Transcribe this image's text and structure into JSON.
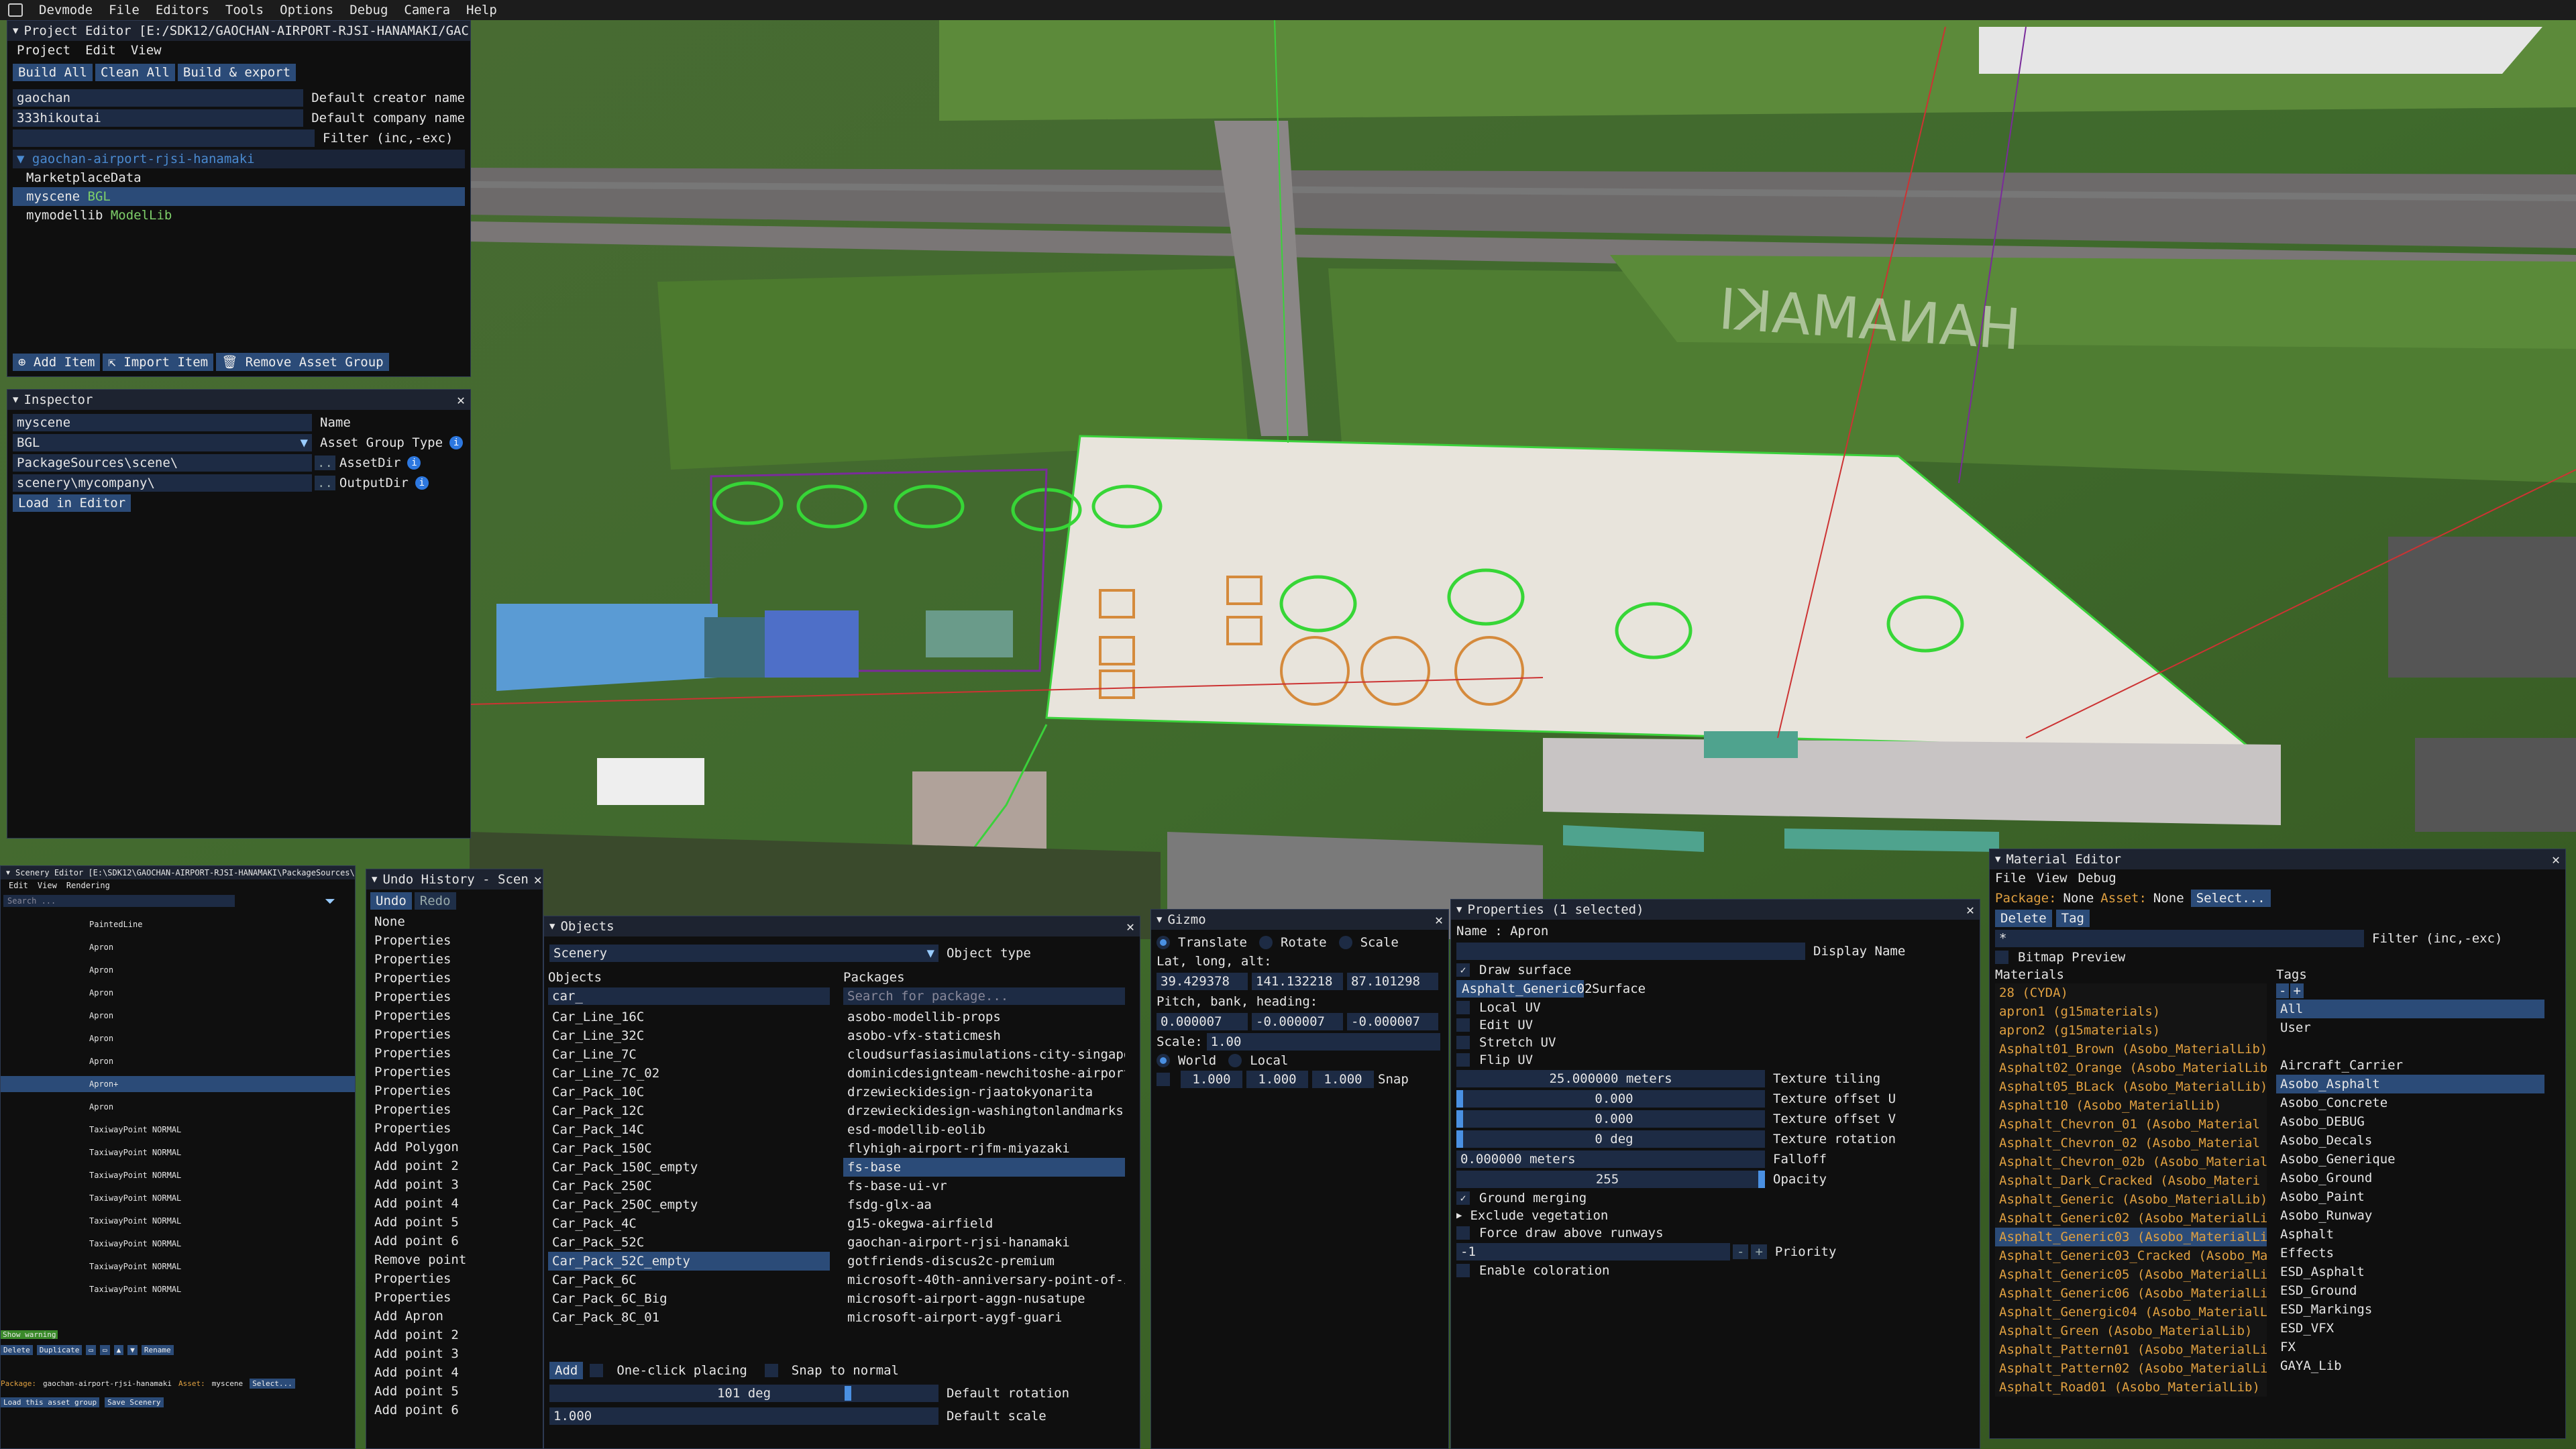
{
  "menubar": {
    "items": [
      "Devmode",
      "File",
      "Editors",
      "Tools",
      "Options",
      "Debug",
      "Camera",
      "Help"
    ]
  },
  "project_editor": {
    "title": "Project Editor [E:/SDK12/GAOCHAN-AIRPORT-RJSI-HANAMAKI/GAC",
    "menu": [
      "Project",
      "Edit",
      "View"
    ],
    "buttons": [
      "Build All",
      "Clean All",
      "Build & export"
    ],
    "creator_value": "gaochan",
    "creator_label": "Default creator name",
    "company_value": "333hikoutai",
    "company_label": "Default company name",
    "filter_label": "Filter (inc,-exc)",
    "tree": [
      {
        "name": "gaochan-airport-rjsi-hanamaki",
        "tag": ""
      },
      {
        "name": "MarketplaceData",
        "tag": ""
      },
      {
        "name": "myscene",
        "tag": "BGL"
      },
      {
        "name": "mymodellib",
        "tag": "ModelLib"
      }
    ],
    "bottom_buttons": [
      "Add Item",
      "Import Item",
      "Remove Asset Group"
    ]
  },
  "inspector": {
    "title": "Inspector",
    "name_value": "myscene",
    "name_label": "Name",
    "type_value": "BGL",
    "type_label": "Asset Group Type",
    "assetdir_value": "PackageSources\\scene\\",
    "assetdir_label": "AssetDir",
    "outputdir_value": "scenery\\mycompany\\",
    "outputdir_label": "OutputDir",
    "load_button": "Load in Editor"
  },
  "scenery_editor": {
    "title": "Scenery Editor [E:\\SDK12\\GAOCHAN-AIRPORT-RJSI-HANAMAKI\\PackageSources\\",
    "menu": [
      "Edit",
      "View",
      "Rendering"
    ],
    "search_placeholder": "Search ...",
    "items": [
      "PaintedLine",
      "Apron",
      "Apron",
      "Apron",
      "Apron",
      "Apron",
      "Apron",
      "Apron+",
      "Apron",
      "TaxiwayPoint NORMAL",
      "TaxiwayPoint NORMAL",
      "TaxiwayPoint NORMAL",
      "TaxiwayPoint NORMAL",
      "TaxiwayPoint NORMAL",
      "TaxiwayPoint NORMAL",
      "TaxiwayPoint NORMAL",
      "TaxiwayPoint NORMAL"
    ],
    "show_warning": "Show warning",
    "buttons": [
      "Delete",
      "Duplicate",
      "Rename"
    ],
    "package_label": "Package:",
    "package_value": "gaochan-airport-rjsi-hanamaki",
    "asset_label": "Asset:",
    "asset_value": "myscene",
    "select_button": "Select...",
    "load_button": "Load this asset group",
    "save_button": "Save Scenery"
  },
  "undo_history": {
    "title": "Undo History - Scen",
    "undo": "Undo",
    "redo": "Redo",
    "items": [
      "None",
      "Properties",
      "Properties",
      "Properties",
      "Properties",
      "Properties",
      "Properties",
      "Properties",
      "Properties",
      "Properties",
      "Properties",
      "Properties",
      "Add Polygon",
      "Add point 2",
      "Add point 3",
      "Add point 4",
      "Add point 5",
      "Add point 6",
      "Remove point",
      "Properties",
      "Properties",
      "Add Apron",
      "Add point 2",
      "Add point 3",
      "Add point 4",
      "Add point 5",
      "Add point 6"
    ]
  },
  "objects": {
    "title": "Objects",
    "type_value": "Scenery",
    "type_label": "Object type",
    "objects_header": "Objects",
    "packages_header": "Packages",
    "objects_search": "car_",
    "packages_search_placeholder": "Search for package...",
    "objects": [
      "Car_Line_16C",
      "Car_Line_32C",
      "Car_Line_7C",
      "Car_Line_7C_02",
      "Car_Pack_10C",
      "Car_Pack_12C",
      "Car_Pack_14C",
      "Car_Pack_150C",
      "Car_Pack_150C_empty",
      "Car_Pack_250C",
      "Car_Pack_250C_empty",
      "Car_Pack_4C",
      "Car_Pack_52C",
      "Car_Pack_52C_empty",
      "Car_Pack_6C",
      "Car_Pack_6C_Big",
      "Car_Pack_8C_01"
    ],
    "packages": [
      "asobo-modellib-props",
      "asobo-vfx-staticmesh",
      "cloudsurfasiasimulations-city-singapo",
      "dominicdesignteam-newchitoshe-airport",
      "drzewieckidesign-rjaatokyonarita",
      "drzewieckidesign-washingtonlandmarks",
      "esd-modellib-eolib",
      "flyhigh-airport-rjfm-miyazaki",
      "fs-base",
      "fs-base-ui-vr",
      "fsdg-glx-aa",
      "g15-okegwa-airfield",
      "gaochan-airport-rjsi-hanamaki",
      "gotfriends-discus2c-premium",
      "microsoft-40th-anniversary-point-of-i",
      "microsoft-airport-aggn-nusatupe",
      "microsoft-airport-aygf-guari"
    ],
    "add_button": "Add",
    "one_click": "One-click placing",
    "snap_normal": "Snap to normal",
    "rotation_value": "101 deg",
    "rotation_label": "Default rotation",
    "scale_value": "1.000",
    "scale_label": "Default scale"
  },
  "gizmo": {
    "title": "Gizmo",
    "modes": [
      "Translate",
      "Rotate",
      "Scale"
    ],
    "latlon_label": "Lat, long, alt:",
    "lat": "39.429378",
    "lon": "141.132218",
    "alt": "87.101298",
    "pbh_label": "Pitch, bank, heading:",
    "pitch": "0.000007",
    "bank": "-0.000007",
    "heading": "-0.000007",
    "scale_label": "Scale:",
    "scale_value": "1.00",
    "spaces": [
      "World",
      "Local"
    ],
    "snap": [
      "1.000",
      "1.000",
      "1.000"
    ],
    "snap_label": "Snap"
  },
  "properties": {
    "title": "Properties (1 selected)",
    "name_label": "Name :",
    "name_value": "Apron",
    "display_name_label": "Display Name",
    "draw_surface": "Draw surface",
    "surface_value": "Asphalt_Generic02",
    "surface_label": "Surface",
    "checks": [
      "Local UV",
      "Edit UV",
      "Stretch UV",
      "Flip UV"
    ],
    "tiling_value": "25.000000 meters",
    "tiling_label": "Texture tiling",
    "offset_u_value": "0.000",
    "offset_u_label": "Texture offset U",
    "offset_v_value": "0.000",
    "offset_v_label": "Texture offset V",
    "rotation_value": "0 deg",
    "rotation_label": "Texture rotation",
    "falloff_value": "0.000000 meters",
    "falloff_label": "Falloff",
    "opacity_value": "255",
    "opacity_label": "Opacity",
    "ground_merging": "Ground merging",
    "exclude_vegetation": "Exclude vegetation",
    "force_draw": "Force draw above runways",
    "priority_value": "-1",
    "priority_label": "Priority",
    "enable_coloration": "Enable coloration"
  },
  "material_editor": {
    "title": "Material Editor",
    "menu": [
      "File",
      "View",
      "Debug"
    ],
    "package_label": "Package:",
    "package_value": "None",
    "asset_label": "Asset:",
    "asset_value": "None",
    "select_button": "Select...",
    "delete_button": "Delete",
    "tag_button": "Tag",
    "filter_value": "*",
    "filter_label": "Filter (inc,-exc)",
    "bitmap_preview": "Bitmap Preview",
    "materials_header": "Materials",
    "tags_header": "Tags",
    "materials": [
      "28 (CYDA)",
      "apron1 (g15materials)",
      "apron2 (g15materials)",
      "Asphalt01_Brown (Asobo_MaterialLib)",
      "Asphalt02_Orange (Asobo_MaterialLib)",
      "Asphalt05_BLack (Asobo_MaterialLib)",
      "Asphalt10 (Asobo_MaterialLib)",
      "Asphalt_Chevron_01 (Asobo_Material",
      "Asphalt_Chevron_02 (Asobo_Material",
      "Asphalt_Chevron_02b (Asobo_Material",
      "Asphalt_Dark_Cracked (Asobo_Materi",
      "Asphalt_Generic (Asobo_MaterialLib)",
      "Asphalt_Generic02 (Asobo_MaterialLi",
      "Asphalt_Generic03 (Asobo_MaterialLi",
      "Asphalt_Generic03_Cracked (Asobo_Ma",
      "Asphalt_Generic05 (Asobo_MaterialLi",
      "Asphalt_Generic06 (Asobo_MaterialLi",
      "Asphalt_Genergic04 (Asobo_MaterialL",
      "Asphalt_Green (Asobo_MaterialLib)",
      "Asphalt_Pattern01 (Asobo_MaterialLi",
      "Asphalt_Pattern02 (Asobo_MaterialLi",
      "Asphalt_Road01 (Asobo_MaterialLib)"
    ],
    "tags": [
      "All",
      "User",
      "",
      "Aircraft_Carrier",
      "Asobo_Asphalt",
      "Asobo_Concrete",
      "Asobo_DEBUG",
      "Asobo_Decals",
      "Asobo_Generique",
      "Asobo_Ground",
      "Asobo_Paint",
      "Asobo_Runway",
      "Asphalt",
      "Effects",
      "ESD_Asphalt",
      "ESD_Ground",
      "ESD_Markings",
      "ESD_VFX",
      "FX",
      "GAYA_Lib"
    ]
  },
  "scene_text": {
    "hanamaki": "HANAMAKI"
  }
}
